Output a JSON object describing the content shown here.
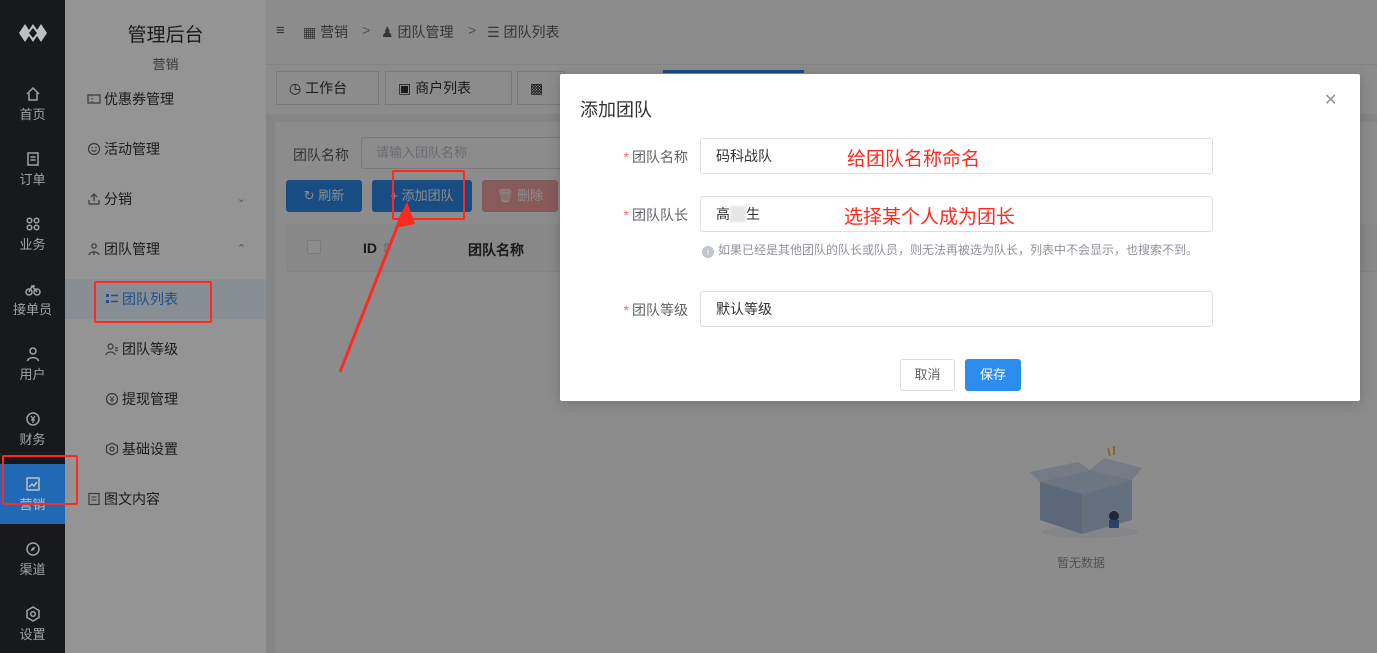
{
  "rail": {
    "items": [
      {
        "label": "首页",
        "icon": "home-icon"
      },
      {
        "label": "订单",
        "icon": "order-icon"
      },
      {
        "label": "业务",
        "icon": "grid-icon"
      },
      {
        "label": "接单员",
        "icon": "bike-icon"
      },
      {
        "label": "用户",
        "icon": "user-icon"
      },
      {
        "label": "财务",
        "icon": "money-icon"
      },
      {
        "label": "营销",
        "icon": "chart-icon",
        "active": true
      },
      {
        "label": "渠道",
        "icon": "compass-icon"
      },
      {
        "label": "设置",
        "icon": "gear-icon"
      }
    ]
  },
  "submenu": {
    "title": "管理后台",
    "subtitle": "营销",
    "items": [
      {
        "label": "优惠券管理",
        "icon": "ticket-icon"
      },
      {
        "label": "活动管理",
        "icon": "smile-icon"
      },
      {
        "label": "分销",
        "icon": "share-icon",
        "chevron": "down"
      },
      {
        "label": "团队管理",
        "icon": "team-icon",
        "chevron": "up"
      },
      {
        "label": "团队列表",
        "icon": "list-icon",
        "child": true,
        "selected": true
      },
      {
        "label": "团队等级",
        "icon": "user-level-icon",
        "child": true
      },
      {
        "label": "提现管理",
        "icon": "withdraw-icon",
        "child": true
      },
      {
        "label": "基础设置",
        "icon": "settings-icon",
        "child": true
      },
      {
        "label": "图文内容",
        "icon": "article-icon"
      }
    ]
  },
  "breadcrumb": {
    "items": [
      "营销",
      "团队管理",
      "团队列表"
    ],
    "separator": ">"
  },
  "tabs": [
    {
      "label": "工作台",
      "icon": "dashboard-icon"
    },
    {
      "label": "商户列表",
      "icon": "merchant-icon"
    }
  ],
  "filter": {
    "label": "团队名称",
    "placeholder": "请输入团队名称"
  },
  "toolbar": {
    "refresh": "刷新",
    "add": "添加团队",
    "delete": "删除"
  },
  "table": {
    "headers": [
      "ID",
      "团队名称"
    ]
  },
  "empty": {
    "text": "暂无数据"
  },
  "modal": {
    "title": "添加团队",
    "fields": [
      {
        "label": "团队名称",
        "value": "码科战队",
        "annotation": "给团队名称命名"
      },
      {
        "label": "团队队长",
        "value_prefix": "高",
        "value_suffix": "生",
        "annotation": "选择某个人成为团长"
      },
      {
        "label": "团队等级",
        "value": "默认等级"
      }
    ],
    "hint": "如果已经是其他团队的队长或队员，则无法再被选为队长，列表中不会显示，也搜索不到。",
    "cancel": "取消",
    "save": "保存"
  },
  "colors": {
    "primary": "#2d8cf0",
    "annotation_red": "#ff2a1f",
    "rail_bg": "#1f2226"
  }
}
